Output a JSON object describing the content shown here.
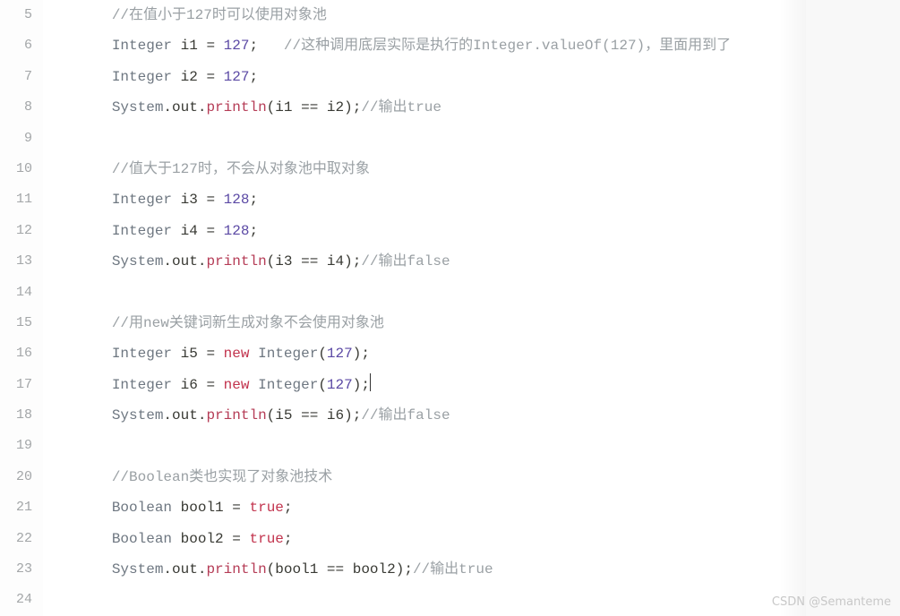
{
  "watermark": "CSDN @Semanteme",
  "lines": [
    {
      "num": 5,
      "indent": "        ",
      "tokens": [
        {
          "t": "//在值小于127时可以使用对象池",
          "c": "cmt"
        }
      ]
    },
    {
      "num": 6,
      "indent": "        ",
      "tokens": [
        {
          "t": "Integer",
          "c": "type"
        },
        {
          "t": " "
        },
        {
          "t": "i1",
          "c": "var"
        },
        {
          "t": " "
        },
        {
          "t": "=",
          "c": "op"
        },
        {
          "t": " "
        },
        {
          "t": "127",
          "c": "num"
        },
        {
          "t": ";",
          "c": "punc"
        },
        {
          "t": "   "
        },
        {
          "t": "//这种调用底层实际是执行的Integer.valueOf(127)，里面用到了",
          "c": "cmt"
        }
      ]
    },
    {
      "num": 7,
      "indent": "        ",
      "tokens": [
        {
          "t": "Integer",
          "c": "type"
        },
        {
          "t": " "
        },
        {
          "t": "i2",
          "c": "var"
        },
        {
          "t": " "
        },
        {
          "t": "=",
          "c": "op"
        },
        {
          "t": " "
        },
        {
          "t": "127",
          "c": "num"
        },
        {
          "t": ";",
          "c": "punc"
        }
      ]
    },
    {
      "num": 8,
      "indent": "        ",
      "tokens": [
        {
          "t": "System",
          "c": "type"
        },
        {
          "t": ".",
          "c": "punc"
        },
        {
          "t": "out",
          "c": "var"
        },
        {
          "t": ".",
          "c": "punc"
        },
        {
          "t": "println",
          "c": "meth"
        },
        {
          "t": "(",
          "c": "punc"
        },
        {
          "t": "i1",
          "c": "var"
        },
        {
          "t": " "
        },
        {
          "t": "==",
          "c": "op"
        },
        {
          "t": " "
        },
        {
          "t": "i2",
          "c": "var"
        },
        {
          "t": ")",
          "c": "punc"
        },
        {
          "t": ";",
          "c": "punc"
        },
        {
          "t": "//输出true",
          "c": "cmt"
        }
      ]
    },
    {
      "num": 9,
      "indent": "",
      "tokens": []
    },
    {
      "num": 10,
      "indent": "        ",
      "tokens": [
        {
          "t": "//值大于127时，不会从对象池中取对象",
          "c": "cmt"
        }
      ]
    },
    {
      "num": 11,
      "indent": "        ",
      "tokens": [
        {
          "t": "Integer",
          "c": "type"
        },
        {
          "t": " "
        },
        {
          "t": "i3",
          "c": "var"
        },
        {
          "t": " "
        },
        {
          "t": "=",
          "c": "op"
        },
        {
          "t": " "
        },
        {
          "t": "128",
          "c": "num"
        },
        {
          "t": ";",
          "c": "punc"
        }
      ]
    },
    {
      "num": 12,
      "indent": "        ",
      "tokens": [
        {
          "t": "Integer",
          "c": "type"
        },
        {
          "t": " "
        },
        {
          "t": "i4",
          "c": "var"
        },
        {
          "t": " "
        },
        {
          "t": "=",
          "c": "op"
        },
        {
          "t": " "
        },
        {
          "t": "128",
          "c": "num"
        },
        {
          "t": ";",
          "c": "punc"
        }
      ]
    },
    {
      "num": 13,
      "indent": "        ",
      "tokens": [
        {
          "t": "System",
          "c": "type"
        },
        {
          "t": ".",
          "c": "punc"
        },
        {
          "t": "out",
          "c": "var"
        },
        {
          "t": ".",
          "c": "punc"
        },
        {
          "t": "println",
          "c": "meth"
        },
        {
          "t": "(",
          "c": "punc"
        },
        {
          "t": "i3",
          "c": "var"
        },
        {
          "t": " "
        },
        {
          "t": "==",
          "c": "op"
        },
        {
          "t": " "
        },
        {
          "t": "i4",
          "c": "var"
        },
        {
          "t": ")",
          "c": "punc"
        },
        {
          "t": ";",
          "c": "punc"
        },
        {
          "t": "//输出false",
          "c": "cmt"
        }
      ]
    },
    {
      "num": 14,
      "indent": "",
      "tokens": []
    },
    {
      "num": 15,
      "indent": "        ",
      "tokens": [
        {
          "t": "//用new关键词新生成对象不会使用对象池",
          "c": "cmt"
        }
      ]
    },
    {
      "num": 16,
      "indent": "        ",
      "tokens": [
        {
          "t": "Integer",
          "c": "type"
        },
        {
          "t": " "
        },
        {
          "t": "i5",
          "c": "var"
        },
        {
          "t": " "
        },
        {
          "t": "=",
          "c": "op"
        },
        {
          "t": " "
        },
        {
          "t": "new",
          "c": "kw"
        },
        {
          "t": " "
        },
        {
          "t": "Integer",
          "c": "type"
        },
        {
          "t": "(",
          "c": "punc"
        },
        {
          "t": "127",
          "c": "num"
        },
        {
          "t": ")",
          "c": "punc"
        },
        {
          "t": ";",
          "c": "punc"
        }
      ]
    },
    {
      "num": 17,
      "indent": "        ",
      "tokens": [
        {
          "t": "Integer",
          "c": "type"
        },
        {
          "t": " "
        },
        {
          "t": "i6",
          "c": "var"
        },
        {
          "t": " "
        },
        {
          "t": "=",
          "c": "op"
        },
        {
          "t": " "
        },
        {
          "t": "new",
          "c": "kw"
        },
        {
          "t": " "
        },
        {
          "t": "Integer",
          "c": "type"
        },
        {
          "t": "(",
          "c": "punc"
        },
        {
          "t": "127",
          "c": "num"
        },
        {
          "t": ")",
          "c": "punc"
        },
        {
          "t": ";",
          "c": "punc",
          "cursor": true
        }
      ]
    },
    {
      "num": 18,
      "indent": "        ",
      "tokens": [
        {
          "t": "System",
          "c": "type"
        },
        {
          "t": ".",
          "c": "punc"
        },
        {
          "t": "out",
          "c": "var"
        },
        {
          "t": ".",
          "c": "punc"
        },
        {
          "t": "println",
          "c": "meth"
        },
        {
          "t": "(",
          "c": "punc"
        },
        {
          "t": "i5",
          "c": "var"
        },
        {
          "t": " "
        },
        {
          "t": "==",
          "c": "op"
        },
        {
          "t": " "
        },
        {
          "t": "i6",
          "c": "var"
        },
        {
          "t": ")",
          "c": "punc"
        },
        {
          "t": ";",
          "c": "punc"
        },
        {
          "t": "//输出false",
          "c": "cmt"
        }
      ]
    },
    {
      "num": 19,
      "indent": "",
      "tokens": []
    },
    {
      "num": 20,
      "indent": "        ",
      "tokens": [
        {
          "t": "//Boolean类也实现了对象池技术",
          "c": "cmt"
        }
      ]
    },
    {
      "num": 21,
      "indent": "        ",
      "tokens": [
        {
          "t": "Boolean",
          "c": "type"
        },
        {
          "t": " "
        },
        {
          "t": "bool1",
          "c": "var"
        },
        {
          "t": " "
        },
        {
          "t": "=",
          "c": "op"
        },
        {
          "t": " "
        },
        {
          "t": "true",
          "c": "kw"
        },
        {
          "t": ";",
          "c": "punc"
        }
      ]
    },
    {
      "num": 22,
      "indent": "        ",
      "tokens": [
        {
          "t": "Boolean",
          "c": "type"
        },
        {
          "t": " "
        },
        {
          "t": "bool2",
          "c": "var"
        },
        {
          "t": " "
        },
        {
          "t": "=",
          "c": "op"
        },
        {
          "t": " "
        },
        {
          "t": "true",
          "c": "kw"
        },
        {
          "t": ";",
          "c": "punc"
        }
      ]
    },
    {
      "num": 23,
      "indent": "        ",
      "tokens": [
        {
          "t": "System",
          "c": "type"
        },
        {
          "t": ".",
          "c": "punc"
        },
        {
          "t": "out",
          "c": "var"
        },
        {
          "t": ".",
          "c": "punc"
        },
        {
          "t": "println",
          "c": "meth"
        },
        {
          "t": "(",
          "c": "punc"
        },
        {
          "t": "bool1",
          "c": "var"
        },
        {
          "t": " "
        },
        {
          "t": "==",
          "c": "op"
        },
        {
          "t": " "
        },
        {
          "t": "bool2",
          "c": "var"
        },
        {
          "t": ")",
          "c": "punc"
        },
        {
          "t": ";",
          "c": "punc"
        },
        {
          "t": "//输出true",
          "c": "cmt"
        }
      ]
    },
    {
      "num": 24,
      "indent": "",
      "tokens": []
    }
  ]
}
